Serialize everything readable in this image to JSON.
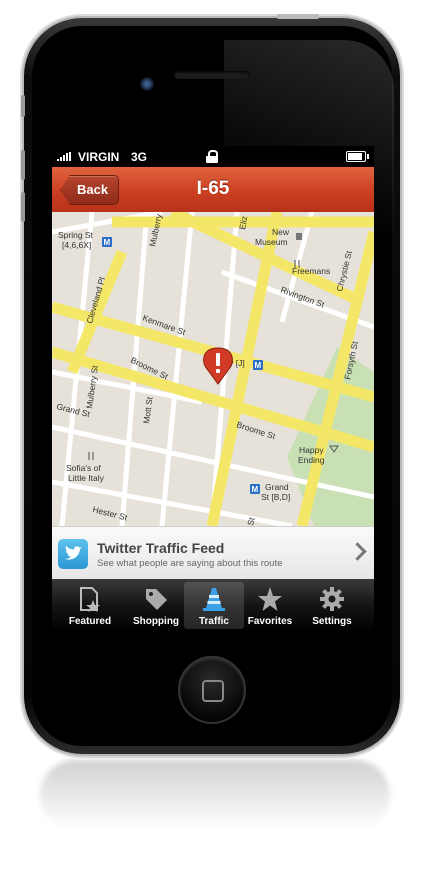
{
  "status_bar": {
    "carrier": "VIRGIN",
    "network": "3G",
    "battery_level": 0.9
  },
  "nav": {
    "back_label": "Back",
    "title": "I-65"
  },
  "map": {
    "labels": {
      "spring_st": "Spring St",
      "spring_st_lines": "[4,6,6X]",
      "mulberry_top": "Mulberry St",
      "elizabeth": "Eliz",
      "new_museum": "New",
      "new_museum2": "Museum",
      "freemans": "Freemans",
      "chrystie": "Chrystie St",
      "rivington": "Rivington St",
      "cleveland": "Cleveland Pl",
      "kenmare": "Kenmare St",
      "bowery": "Bowery [J]",
      "forsyth": "Forsyth St",
      "broome_left": "Broome St",
      "mulberry": "Mulberry St",
      "mott": "Mott St",
      "grand_left": "Grand St",
      "broome_right": "Broome St",
      "happy": "Happy",
      "ending": "Ending",
      "sofias": "Sofia's of",
      "little_italy": "Little Italy",
      "grand_station": "Grand",
      "grand_station_lines": "St [B,D]",
      "hester": "Hester St",
      "st_bottom": "St"
    }
  },
  "twitter": {
    "title": "Twitter Traffic Feed",
    "subtitle": "See what people are saying about this route"
  },
  "tabs": [
    {
      "label": "Featured",
      "icon": "featured-icon",
      "active": false
    },
    {
      "label": "Shopping",
      "icon": "tag-icon",
      "active": false
    },
    {
      "label": "Traffic",
      "icon": "traffic-cone-icon",
      "active": true
    },
    {
      "label": "Favorites",
      "icon": "star-icon",
      "active": false
    },
    {
      "label": "Settings",
      "icon": "gear-icon",
      "active": false
    }
  ],
  "colors": {
    "nav_red": "#cc3f22",
    "road_yellow": "#f7e96b",
    "map_bg": "#eae6de",
    "park_green": "#c9dfb4",
    "pin_red": "#d13b26"
  }
}
